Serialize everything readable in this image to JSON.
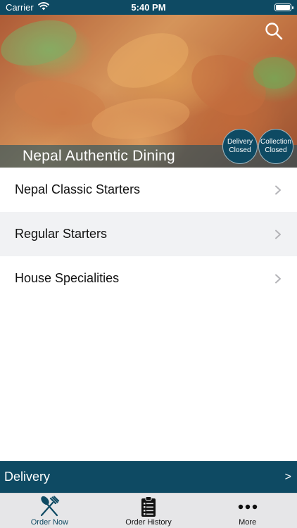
{
  "status_bar": {
    "carrier": "Carrier",
    "time": "5:40 PM",
    "icons": [
      "wifi-icon",
      "battery-icon"
    ]
  },
  "header": {
    "restaurant_name": "Nepal Authentic Dining",
    "search_icon": "search-icon",
    "delivery_status": {
      "line1": "Delivery",
      "line2": "Closed"
    },
    "collection_status": {
      "line1": "Collection",
      "line2": "Closed"
    }
  },
  "menu": {
    "categories": [
      {
        "label": "Nepal Classic Starters"
      },
      {
        "label": "Regular Starters"
      },
      {
        "label": "House Specialities"
      }
    ],
    "chevron_icon": "chevron-right-icon"
  },
  "order_mode_bar": {
    "label": "Delivery",
    "arrow": ">"
  },
  "tab_bar": {
    "tabs": [
      {
        "label": "Order Now",
        "icon": "fork-knife-icon",
        "active": true
      },
      {
        "label": "Order History",
        "icon": "clipboard-list-icon",
        "active": false
      },
      {
        "label": "More",
        "icon": "more-dots-icon",
        "active": false
      }
    ]
  },
  "colors": {
    "primary": "#0e4a63",
    "alt_row": "#f1f2f4",
    "tab_bar_bg": "#e6e6e8",
    "chevron": "#b4b4b8"
  }
}
